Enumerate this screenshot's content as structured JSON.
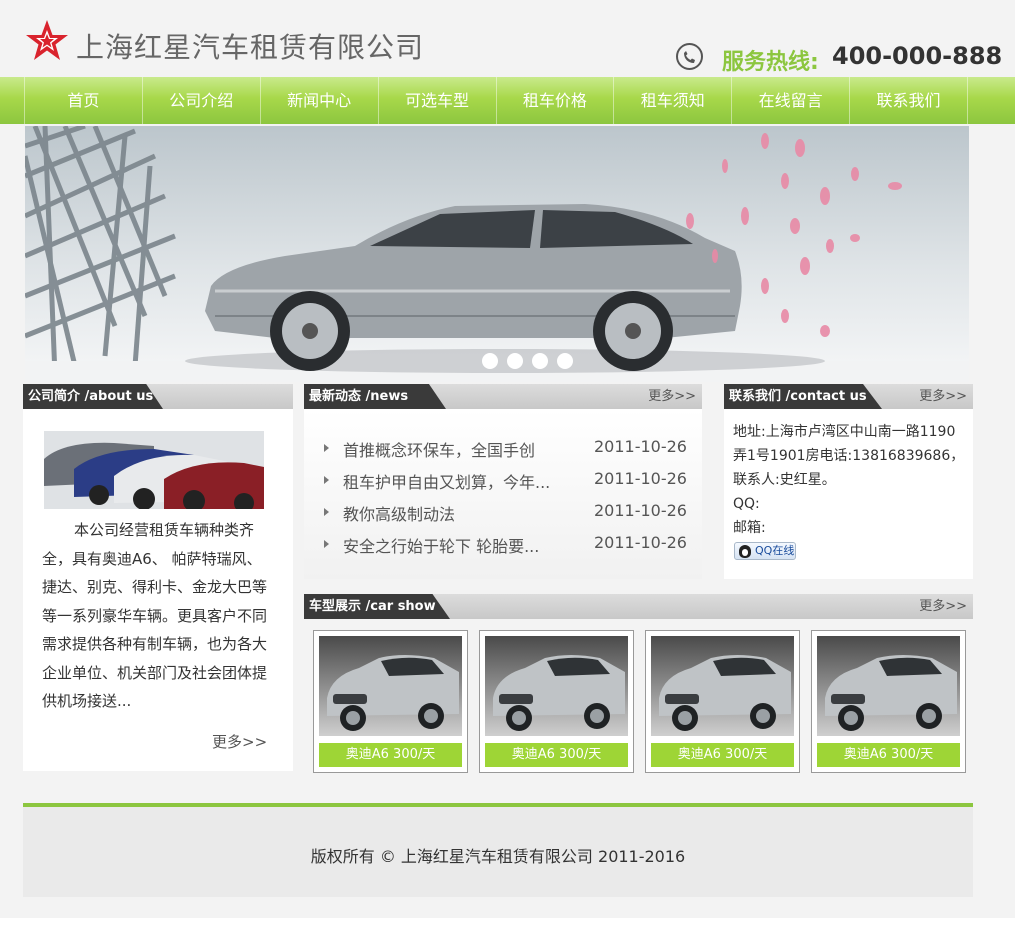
{
  "header": {
    "company_name": "上海红星汽车租赁有限公司",
    "hotline_label": "服务热线:",
    "hotline_number": "400-000-888",
    "logo_icon": "red-star-icon",
    "phone_icon": "phone-icon"
  },
  "nav": {
    "items": [
      "首页",
      "公司介绍",
      "新闻中心",
      "可选车型",
      "租车价格",
      "租车须知",
      "在线留言",
      "联系我们"
    ]
  },
  "banner": {
    "slide_count": 4
  },
  "about": {
    "title": "公司简介 /about us",
    "text": "本公司经营租赁车辆种类齐全，具有奥迪A6、 帕萨特瑞风、捷达、别克、得利卡、金龙大巴等等一系列豪华车辆。更具客户不同需求提供各种有制车辆，也为各大企业单位、机关部门及社会团体提供机场接送...",
    "more": "更多>>"
  },
  "news": {
    "title": "最新动态 /news",
    "more": "更多>>",
    "items": [
      {
        "title": "首推概念环保车，全国手创",
        "date": "2011-10-26"
      },
      {
        "title": "租车护甲自由又划算，今年...",
        "date": "2011-10-26"
      },
      {
        "title": "教你高级制动法",
        "date": "2011-10-26"
      },
      {
        "title": "安全之行始于轮下 轮胎要...",
        "date": "2011-10-26"
      }
    ]
  },
  "contact": {
    "title": "联系我们 /contact us",
    "more": "更多>>",
    "address": "地址:上海市卢湾区中山南一路1190弄1号1901房电话:13816839686，联系人:史红星。",
    "qq": "QQ:",
    "email": "邮箱:",
    "qq_button": "QQ在线"
  },
  "carshow": {
    "title": "车型展示 /car show",
    "more": "更多>>",
    "cars": [
      {
        "price": "奥迪A6 300/天"
      },
      {
        "price": "奥迪A6 300/天"
      },
      {
        "price": "奥迪A6 300/天"
      },
      {
        "price": "奥迪A6 300/天"
      }
    ]
  },
  "footer": {
    "copyright": "版权所有 © 上海红星汽车租赁有限公司 2011-2016"
  },
  "colors": {
    "accent_green": "#8cc63f",
    "logo_red": "#d9232d",
    "section_tab": "#3a3a3a"
  }
}
